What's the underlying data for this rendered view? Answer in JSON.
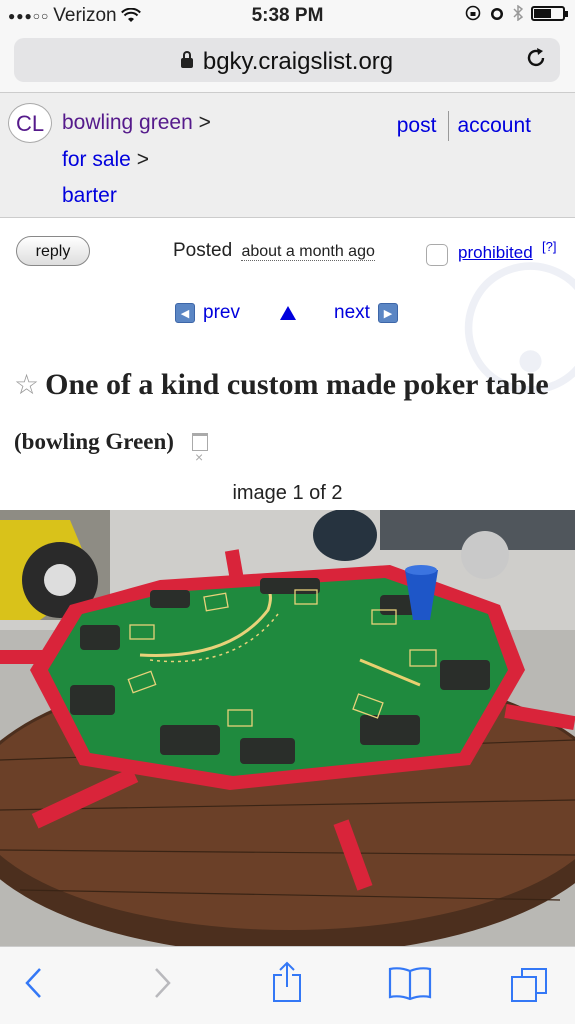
{
  "status_bar": {
    "carrier": "Verizon",
    "time": "5:38 PM"
  },
  "url_bar": {
    "domain": "bgky.craigslist.org"
  },
  "header": {
    "logo": "CL",
    "breadcrumbs": [
      "bowling green",
      "for sale",
      "barter"
    ],
    "separator": ">",
    "links": {
      "post": "post",
      "account": "account"
    }
  },
  "posting": {
    "reply_label": "reply",
    "posted_label": "Posted",
    "posted_ago": "about a month ago",
    "prohibited_label": "prohibited",
    "help_label": "[?]",
    "prev_label": "prev",
    "next_label": "next",
    "title": "One of a kind custom made poker table",
    "location": "(bowling Green)",
    "image_count": "image 1 of 2"
  },
  "colors": {
    "visited_link": "#551a8b",
    "link": "#0000dd",
    "ios_blue": "#3478f6",
    "felt": "#1f8a3e",
    "rail": "#d9243a"
  },
  "icons": [
    "wifi-icon",
    "lock-icon",
    "reload-icon",
    "star-icon",
    "trash-icon",
    "back-icon",
    "forward-icon",
    "share-icon",
    "bookmarks-icon",
    "tabs-icon"
  ]
}
